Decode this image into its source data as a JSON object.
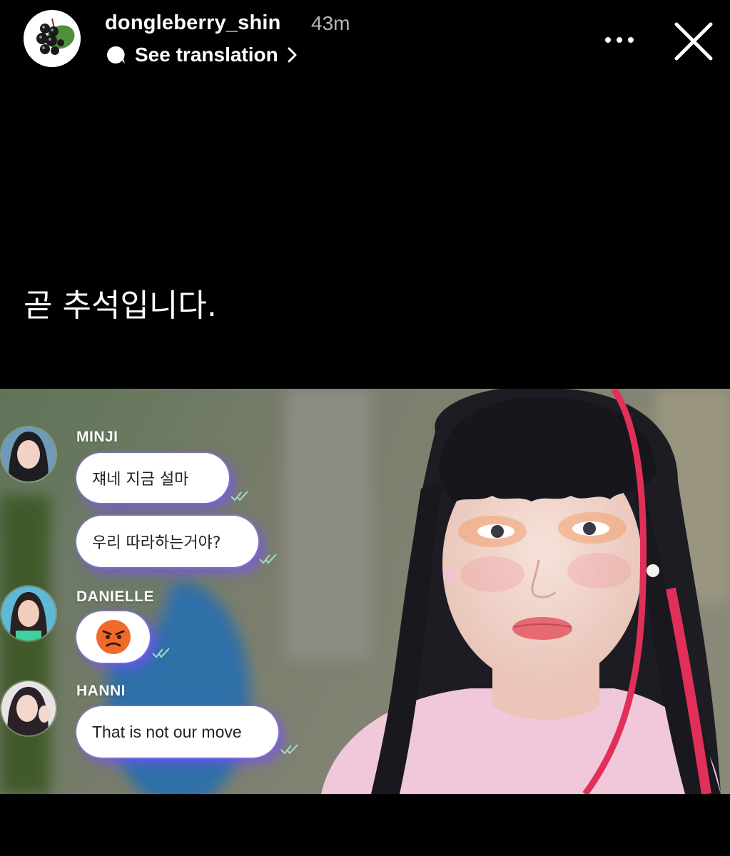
{
  "header": {
    "username": "dongleberry_shin",
    "time": "43m",
    "translate_label": "See translation",
    "icons": {
      "avatar": "blackcurrant-avatar",
      "translate": "speech-bubble-icon",
      "chevron": "chevron-right-icon",
      "more": "more-icon",
      "close": "close-icon"
    }
  },
  "caption": "곧 추석입니다.",
  "media": {
    "messages": [
      {
        "sender": "MINJI",
        "bubbles": [
          "쟤네 지금 설마",
          "우리 따라하는거야?"
        ]
      },
      {
        "sender": "DANIELLE",
        "bubbles": [
          "😡"
        ]
      },
      {
        "sender": "HANNI",
        "bubbles": [
          "That is not our move"
        ]
      }
    ]
  },
  "colors": {
    "background": "#000000",
    "bubble_glow": "#7850ff",
    "time": "#b8b8b8"
  }
}
